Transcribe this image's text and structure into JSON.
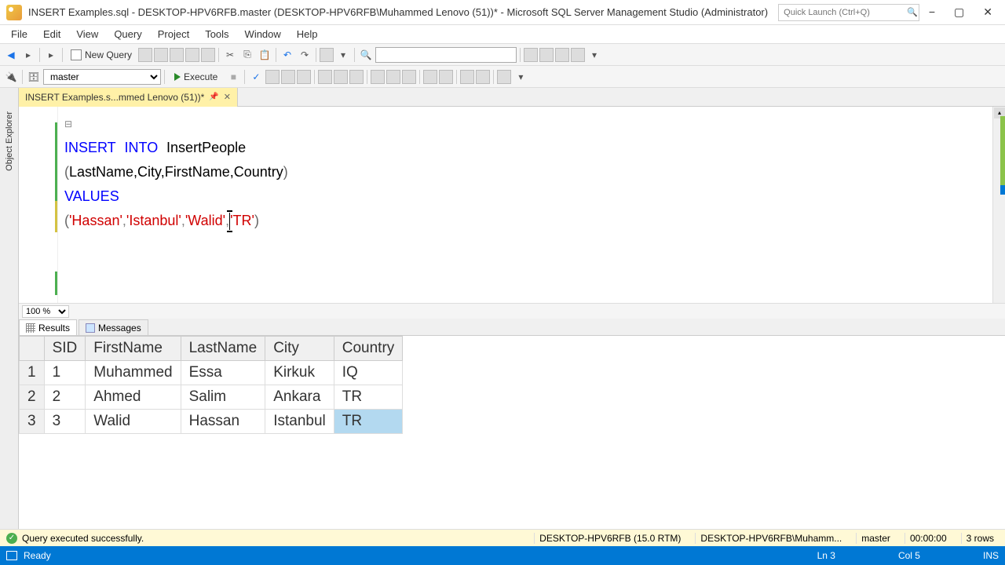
{
  "title": "INSERT Examples.sql - DESKTOP-HPV6RFB.master (DESKTOP-HPV6RFB\\Muhammed Lenovo (51))* - Microsoft SQL Server Management Studio (Administrator)",
  "quick_launch": {
    "placeholder": "Quick Launch (Ctrl+Q)"
  },
  "menu": {
    "file": "File",
    "edit": "Edit",
    "view": "View",
    "query": "Query",
    "project": "Project",
    "tools": "Tools",
    "window": "Window",
    "help": "Help"
  },
  "toolbar": {
    "new_query": "New Query",
    "database_dropdown": "master",
    "execute": "Execute"
  },
  "object_explorer_label": "Object Explorer",
  "tab": {
    "label": "INSERT Examples.s...mmed Lenovo (51))*"
  },
  "code": {
    "line1_kw1": "INSERT",
    "line1_kw2": "INTO",
    "line1_ident": "InsertPeople",
    "line2_cols": "LastName,City,FirstName,Country",
    "line3_kw": "VALUES",
    "line4_v1": "'Hassan'",
    "line4_v2": "'Istanbul'",
    "line4_v3": "'Walid'",
    "line4_v4": "'TR'"
  },
  "zoom": "100 %",
  "result_tabs": {
    "results": "Results",
    "messages": "Messages"
  },
  "grid": {
    "headers": {
      "c0": "SID",
      "c1": "FirstName",
      "c2": "LastName",
      "c3": "City",
      "c4": "Country"
    },
    "rows": [
      {
        "n": "1",
        "sid": "1",
        "first": "Muhammed",
        "last": "Essa",
        "city": "Kirkuk",
        "country": "IQ"
      },
      {
        "n": "2",
        "sid": "2",
        "first": "Ahmed",
        "last": "Salim",
        "city": "Ankara",
        "country": "TR"
      },
      {
        "n": "3",
        "sid": "3",
        "first": "Walid",
        "last": "Hassan",
        "city": "Istanbul",
        "country": "TR"
      }
    ]
  },
  "status1": {
    "msg": "Query executed successfully.",
    "server": "DESKTOP-HPV6RFB (15.0 RTM)",
    "user": "DESKTOP-HPV6RFB\\Muhamm...",
    "db": "master",
    "time": "00:00:00",
    "rows": "3 rows"
  },
  "status2": {
    "ready": "Ready",
    "ln": "Ln 3",
    "col": "Col 5",
    "ins": "INS"
  }
}
